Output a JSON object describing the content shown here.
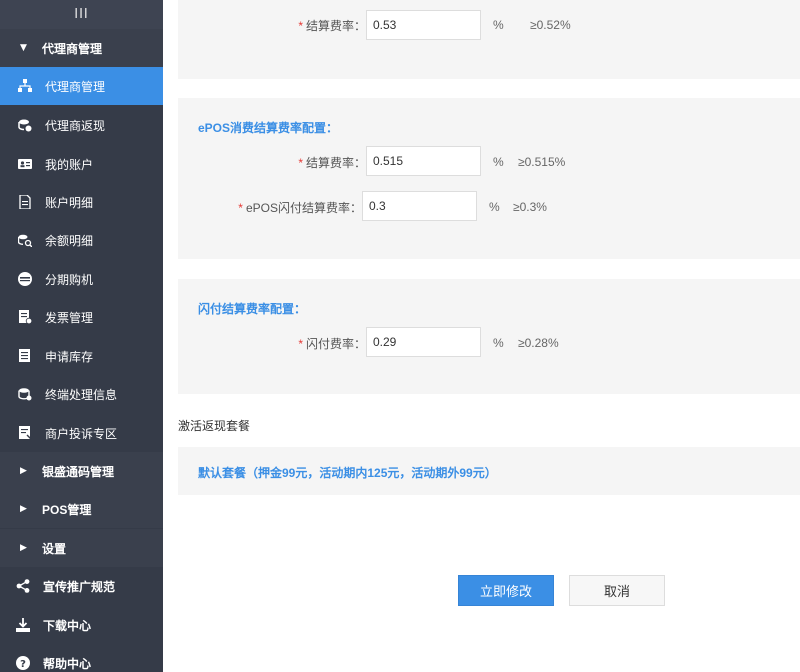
{
  "sidebar": {
    "toggle_glyph": "III",
    "items": [
      {
        "label": "代理商管理",
        "type": "group",
        "caret": "▼",
        "icon": "caret-down-icon"
      },
      {
        "label": "代理商管理",
        "type": "sub",
        "active": true,
        "icon": "sitemap-icon"
      },
      {
        "label": "代理商返现",
        "type": "sub",
        "icon": "coins-icon"
      },
      {
        "label": "我的账户",
        "type": "sub",
        "icon": "id-card-icon"
      },
      {
        "label": "账户明细",
        "type": "sub",
        "icon": "document-icon"
      },
      {
        "label": "余额明细",
        "type": "sub",
        "icon": "coin-search-icon"
      },
      {
        "label": "分期购机",
        "type": "sub",
        "icon": "card-icon"
      },
      {
        "label": "发票管理",
        "type": "sub",
        "icon": "invoice-icon"
      },
      {
        "label": "申请库存",
        "type": "sub",
        "icon": "list-icon"
      },
      {
        "label": "终端处理信息",
        "type": "sub",
        "icon": "coin-stack-icon"
      },
      {
        "label": "商户投诉专区",
        "type": "sub",
        "icon": "complaint-icon"
      },
      {
        "label": "银盛通码管理",
        "type": "group",
        "caret": "▶",
        "icon": "caret-right-icon"
      },
      {
        "label": "POS管理",
        "type": "group",
        "caret": "▶",
        "icon": "caret-right-icon"
      },
      {
        "label": "设置",
        "type": "group",
        "caret": "▶",
        "icon": "caret-right-icon"
      },
      {
        "label": "宣传推广规范",
        "type": "top",
        "icon": "share-icon"
      },
      {
        "label": "下载中心",
        "type": "top",
        "icon": "download-icon"
      },
      {
        "label": "帮助中心",
        "type": "top",
        "icon": "help-icon"
      }
    ]
  },
  "section_top": {
    "rate_label": "结算费率：",
    "rate_value": "0.53",
    "rate_unit": "%",
    "rate_hint": "≥0.52%"
  },
  "section_epos": {
    "title": "ePOS消费结算费率配置：",
    "rate_label": "结算费率：",
    "rate_value": "0.515",
    "rate_unit": "%",
    "rate_hint": "≥0.515%",
    "flash_label": "ePOS闪付结算费率：",
    "flash_value": "0.3",
    "flash_unit": "%",
    "flash_hint": "≥0.3%"
  },
  "section_flash": {
    "title": "闪付结算费率配置：",
    "rate_label": "闪付费率：",
    "rate_value": "0.29",
    "rate_unit": "%",
    "rate_hint": "≥0.28%"
  },
  "activation": {
    "title": "激活返现套餐",
    "package": "默认套餐（押金99元，活动期内125元，活动期外99元）"
  },
  "buttons": {
    "submit": "立即修改",
    "cancel": "取消"
  },
  "colors": {
    "sidebar_bg": "#353b48",
    "accent": "#3b8fe5",
    "required": "#e53935",
    "panel_bg": "#f5f5f5"
  }
}
